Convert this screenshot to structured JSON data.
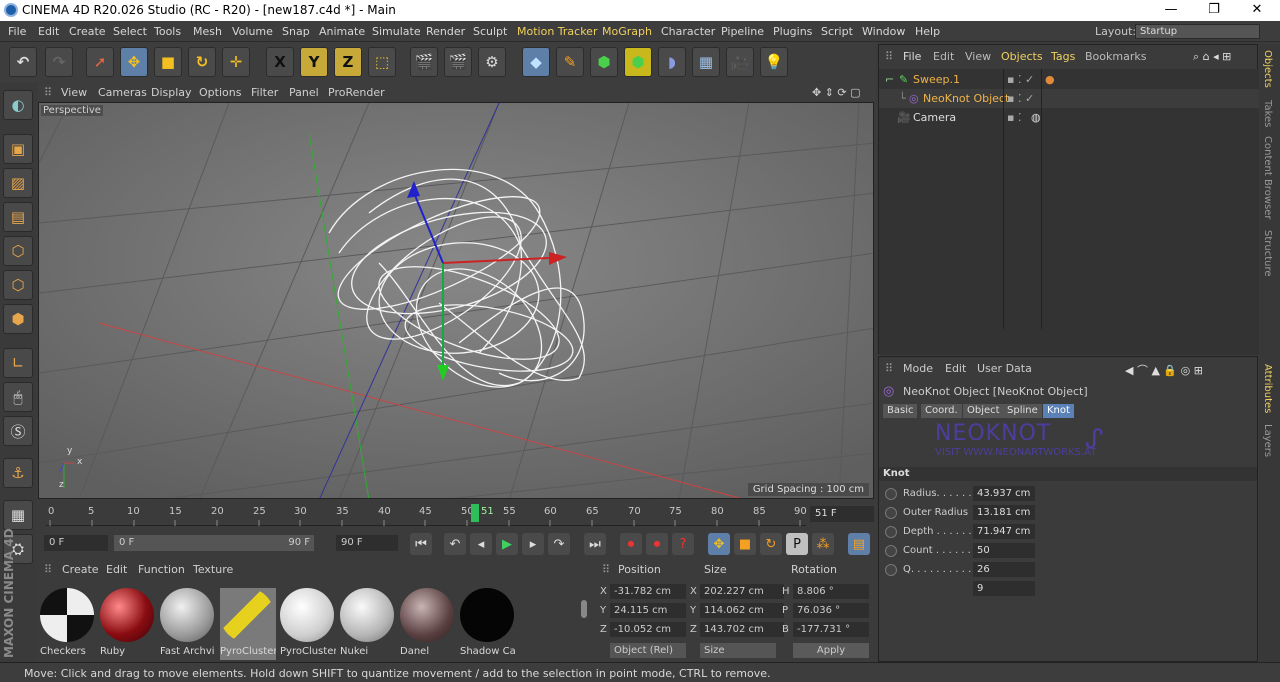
{
  "window": {
    "title": "CINEMA 4D R20.026 Studio (RC - R20) - [new187.c4d *] - Main",
    "minimize": "—",
    "maximize": "❐",
    "close": "✕"
  },
  "menu": {
    "items": [
      "File",
      "Edit",
      "Create",
      "Select",
      "Tools",
      "Mesh",
      "Volume",
      "Snap",
      "Animate",
      "Simulate",
      "Render",
      "Sculpt",
      "Motion Tracker",
      "MoGraph",
      "Character",
      "Pipeline",
      "Plugins",
      "Script",
      "Window",
      "Help"
    ],
    "layout_label": "Layout:",
    "layout_value": "Startup"
  },
  "toolbar": {
    "x_axis": "X",
    "y_axis": "Y",
    "z_axis": "Z"
  },
  "viewport": {
    "menu": [
      "View",
      "Cameras",
      "Display",
      "Options",
      "Filter",
      "Panel",
      "ProRender"
    ],
    "label": "Perspective",
    "grid_spacing": "Grid Spacing : 100 cm",
    "axis_y": "y",
    "axis_x": "x",
    "axis_z": "z"
  },
  "timeline": {
    "ticks": [
      "0",
      "5",
      "10",
      "15",
      "20",
      "25",
      "30",
      "35",
      "40",
      "45",
      "50",
      "55",
      "60",
      "65",
      "70",
      "75",
      "80",
      "85",
      "90"
    ],
    "playhead": "51",
    "current_frame": "51 F",
    "start_frame": "0 F",
    "range_start": "0 F",
    "range_end": "90 F",
    "end_frame": "90 F"
  },
  "materials": {
    "menu": [
      "Create",
      "Edit",
      "Function",
      "Texture"
    ],
    "items": [
      {
        "name": "Checkers"
      },
      {
        "name": "Ruby"
      },
      {
        "name": "Fast Archvi"
      },
      {
        "name": "PyroCluster"
      },
      {
        "name": "PyroCluster"
      },
      {
        "name": "Nukei"
      },
      {
        "name": "Danel"
      },
      {
        "name": "Shadow Ca"
      }
    ]
  },
  "coordinates": {
    "headers": {
      "position": "Position",
      "size": "Size",
      "rotation": "Rotation"
    },
    "rows": [
      {
        "axis": "X",
        "pos": "-31.782 cm",
        "saxis": "X",
        "size": "202.227 cm",
        "raxis": "H",
        "rot": "8.806 °"
      },
      {
        "axis": "Y",
        "pos": "24.115 cm",
        "saxis": "Y",
        "size": "114.062 cm",
        "raxis": "P",
        "rot": "76.036 °"
      },
      {
        "axis": "Z",
        "pos": "-10.052 cm",
        "saxis": "Z",
        "size": "143.702 cm",
        "raxis": "B",
        "rot": "-177.731 °"
      }
    ],
    "mode": "Object (Rel)",
    "size_mode": "Size",
    "apply": "Apply"
  },
  "object_manager": {
    "menu": [
      "File",
      "Edit",
      "View",
      "Objects",
      "Tags",
      "Bookmarks"
    ],
    "objects": [
      {
        "name": "Sweep.1"
      },
      {
        "name": "NeoKnot Object"
      },
      {
        "name": "Camera"
      }
    ]
  },
  "right_tabs": [
    "Objects",
    "Takes",
    "Content Browser",
    "Structure",
    "Attributes",
    "Layers"
  ],
  "attributes": {
    "menu": [
      "Mode",
      "Edit",
      "User Data"
    ],
    "object_title": "NeoKnot Object [NeoKnot Object]",
    "tabs": [
      "Basic",
      "Coord.",
      "Object",
      "Spline",
      "Knot"
    ],
    "banner": "NEOKNOT",
    "banner_url": "VISIT WWW.NEONARTWORKS.AT",
    "section": "Knot",
    "fields": [
      {
        "label": "Radius. . . . . .",
        "value": "43.937 cm"
      },
      {
        "label": "Outer Radius",
        "value": "13.181 cm"
      },
      {
        "label": "Depth . . . . . .",
        "value": "71.947 cm"
      },
      {
        "label": "Count . . . . . .",
        "value": "50"
      },
      {
        "label": "Q. . . . . . . . . .",
        "value": "26"
      },
      {
        "label": "",
        "value": "9"
      }
    ]
  },
  "status": "Move: Click and drag to move elements. Hold down SHIFT to quantize movement / add to the selection in point mode, CTRL to remove.",
  "brand": "MAXON CINEMA 4D"
}
